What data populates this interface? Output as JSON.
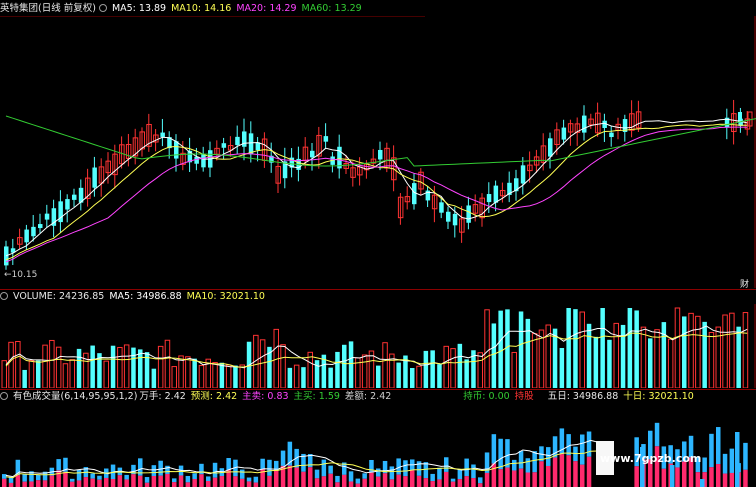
{
  "colors": {
    "up": "#ff3333",
    "down": "#54ffff",
    "ma5": "#ffffff",
    "ma10": "#ffff55",
    "ma20": "#ff44ff",
    "ma60": "#33cc33",
    "grid": "#8b0000",
    "ind_up": "#ff2a6d",
    "ind_down": "#2db6ff"
  },
  "price_panel": {
    "title": "英特集团(日线 前复权)",
    "ma5_label": "MA5: 13.89",
    "ma10_label": "MA10: 14.16",
    "ma20_label": "MA20: 14.29",
    "ma60_label": "MA60: 13.29",
    "low_label": "←10.15",
    "side_char": "财",
    "icon": "circle-icon"
  },
  "volume_panel": {
    "title": "VOLUME: 24236.85",
    "ma5_label": "MA5: 34986.88",
    "ma10_label": "MA10: 32021.10",
    "icon": "circle-icon"
  },
  "indicator_panel": {
    "title": "有色成交量(6,14,95,95,1,2)",
    "wanshou": "万手: 2.42",
    "yuce": "预测: 2.42",
    "zhumai": "主卖: 0.83",
    "zhumai2": "主买: 1.59",
    "chae": "差额: 2.42",
    "chibi": "持币: 0.00",
    "chigu": "持股",
    "wuri": "五日: 34986.88",
    "shiri": "十日: 32021.10",
    "icon": "circle-icon"
  },
  "watermark": "www.7gpzb.com"
}
